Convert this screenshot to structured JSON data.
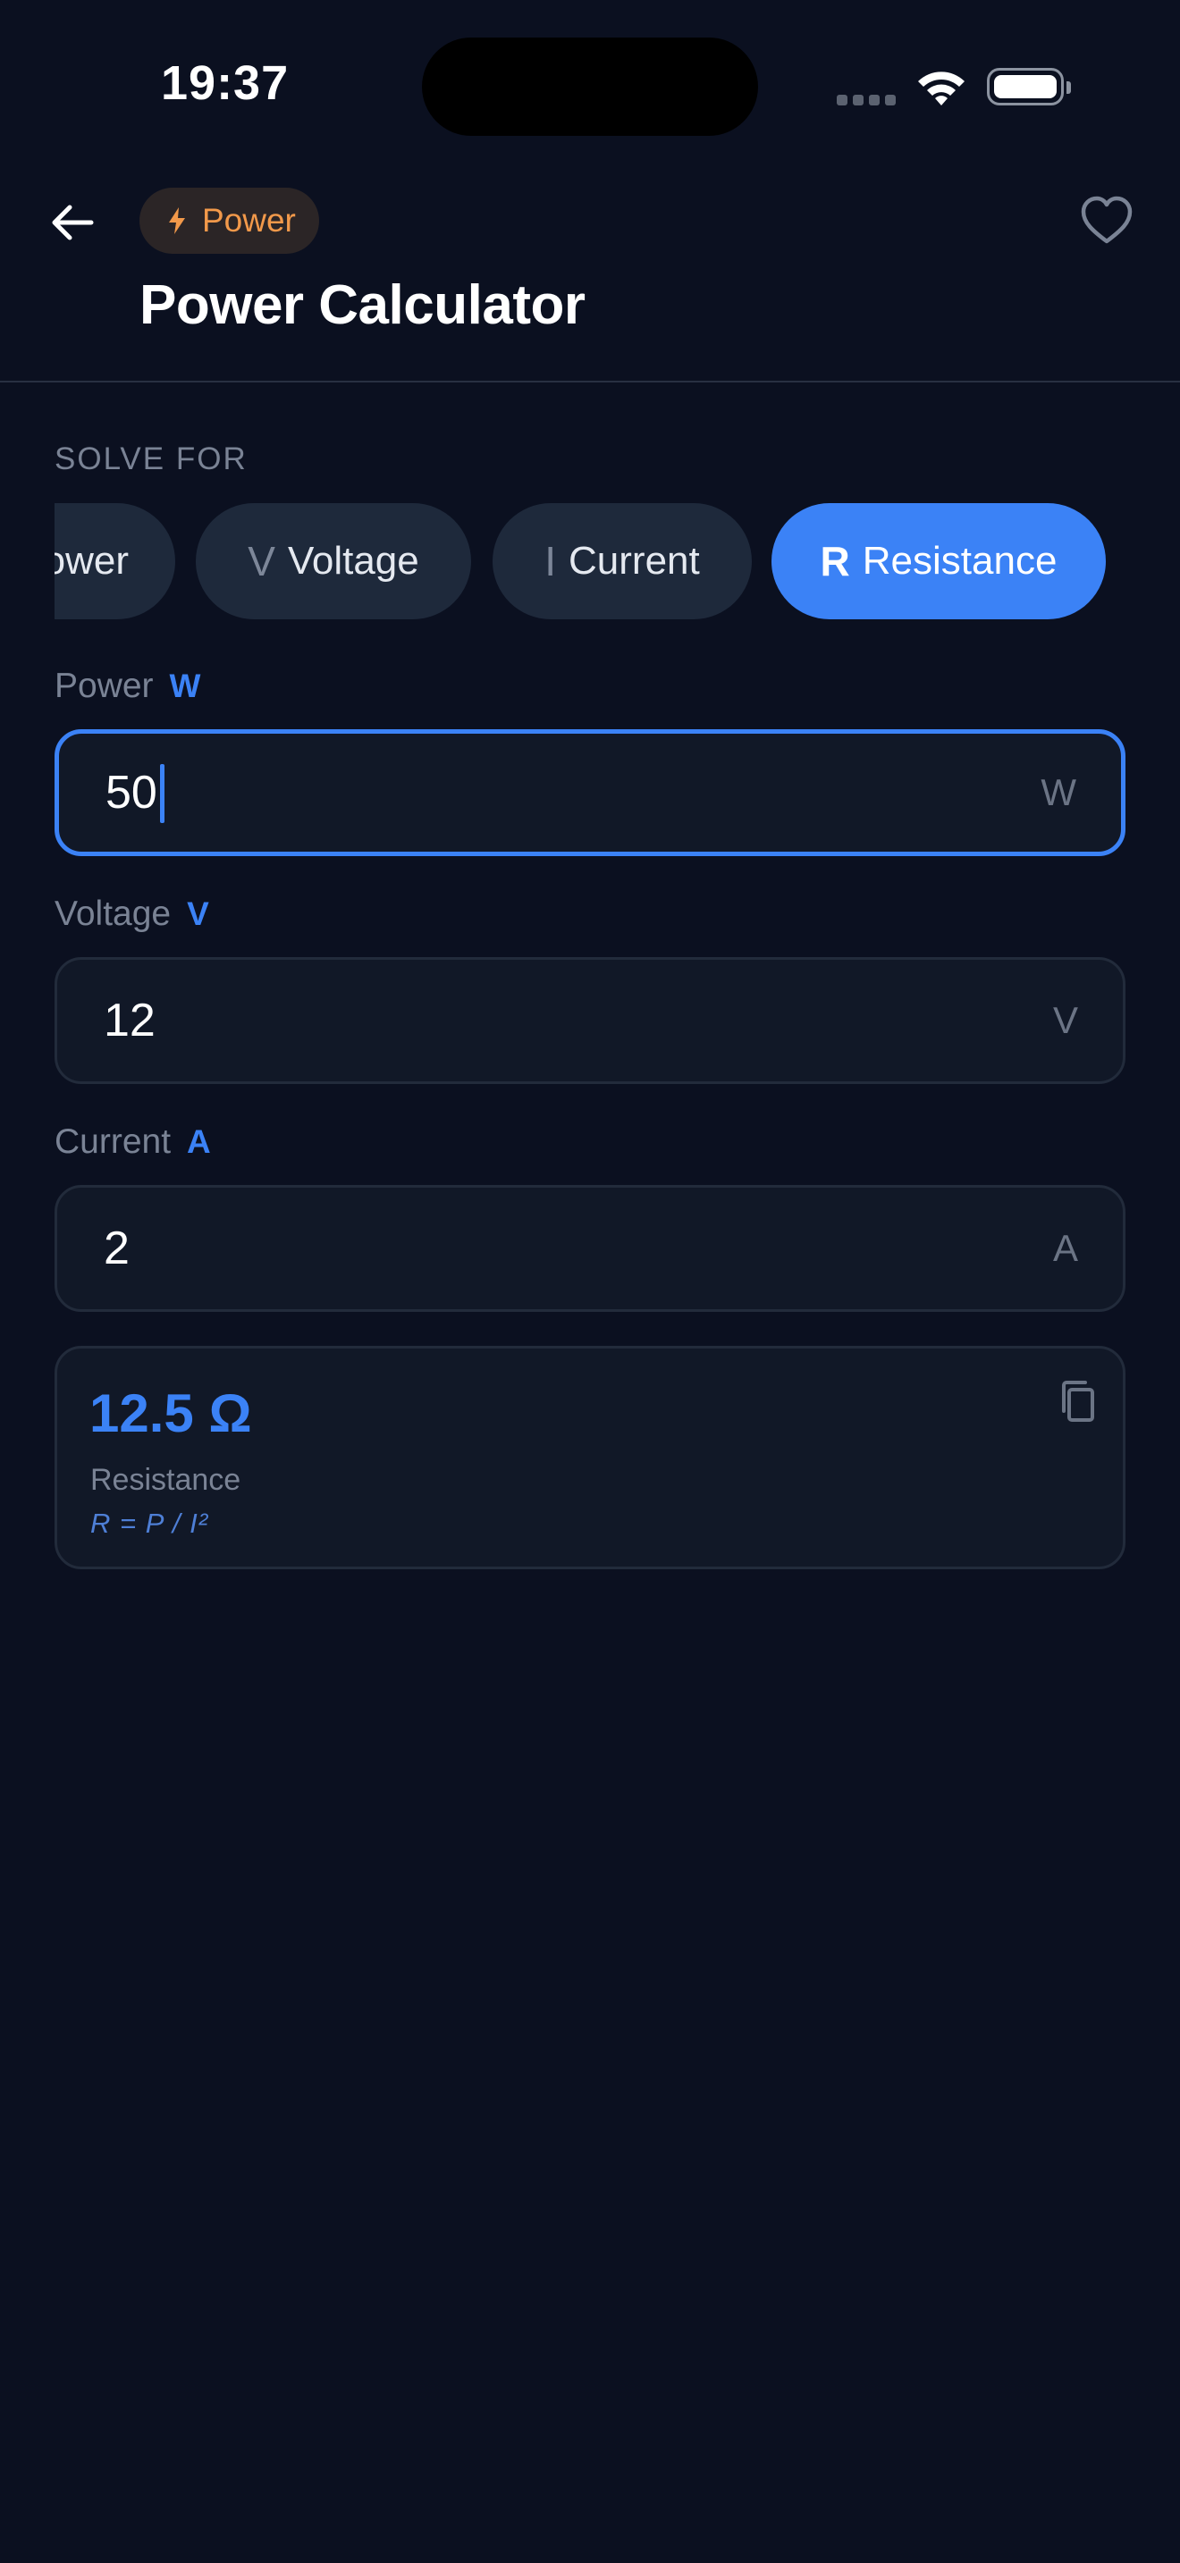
{
  "status": {
    "time": "19:37"
  },
  "header": {
    "badge_label": "Power",
    "title": "Power Calculator"
  },
  "solve_for": {
    "label": "SOLVE FOR",
    "options": [
      {
        "symbol": "",
        "label": "ower"
      },
      {
        "symbol": "V",
        "label": "Voltage"
      },
      {
        "symbol": "I",
        "label": "Current"
      },
      {
        "symbol": "R",
        "label": "Resistance"
      }
    ],
    "selected": "Resistance"
  },
  "fields": [
    {
      "label": "Power",
      "unit_tag": "W",
      "value": "50",
      "unit": "W"
    },
    {
      "label": "Voltage",
      "unit_tag": "V",
      "value": "12",
      "unit": "V"
    },
    {
      "label": "Current",
      "unit_tag": "A",
      "value": "2",
      "unit": "A"
    }
  ],
  "result": {
    "value": "12.5 Ω",
    "name": "Resistance",
    "formula": "R = P / I²"
  },
  "colors": {
    "background": "#0b1020",
    "accent": "#3b82f6",
    "badge_text": "#f2994a"
  },
  "icons": {
    "back": "arrow-left-icon",
    "badge": "bolt-icon",
    "favorite": "heart-outline-icon",
    "copy": "copy-icon"
  }
}
